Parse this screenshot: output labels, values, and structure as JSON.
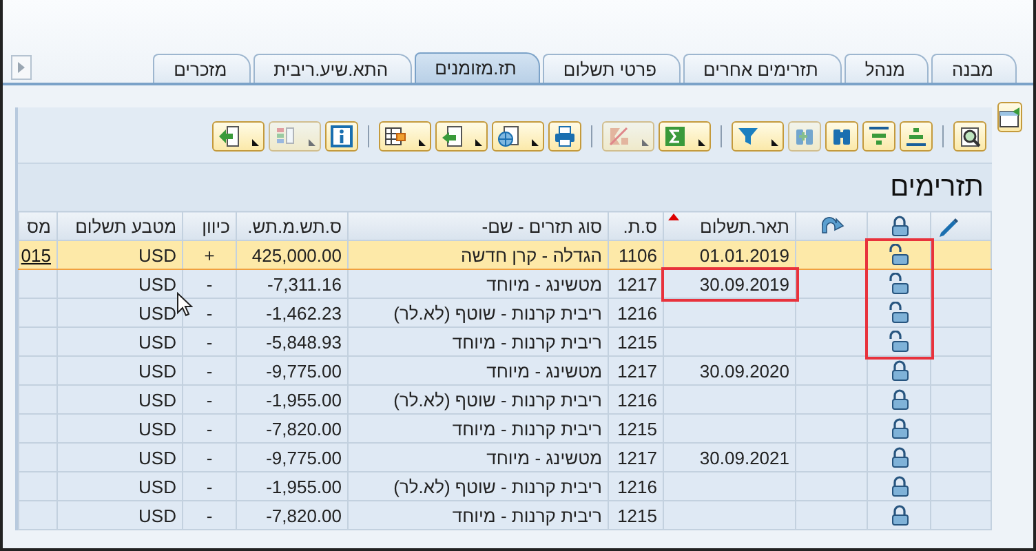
{
  "tabs": [
    {
      "label": "מבנה",
      "selected": false
    },
    {
      "label": "מנהל",
      "selected": false
    },
    {
      "label": "תזרימים אחרים",
      "selected": false
    },
    {
      "label": "פרטי תשלום",
      "selected": false
    },
    {
      "label": "תז.מזומנים",
      "selected": true
    },
    {
      "label": "התא.שיע.ריבית",
      "selected": false
    },
    {
      "label": "מזכרים",
      "selected": false
    }
  ],
  "toolbar": [
    {
      "kind": "detail",
      "dropdown": false,
      "disabled": false
    },
    {
      "kind": "separator"
    },
    {
      "kind": "sort_asc",
      "dropdown": false,
      "disabled": false
    },
    {
      "kind": "sort_desc",
      "dropdown": false,
      "disabled": false
    },
    {
      "kind": "find",
      "dropdown": false,
      "disabled": false
    },
    {
      "kind": "find_next",
      "dropdown": false,
      "disabled": true
    },
    {
      "kind": "filter",
      "dropdown": true,
      "disabled": false
    },
    {
      "kind": "separator"
    },
    {
      "kind": "sum",
      "dropdown": true,
      "disabled": false
    },
    {
      "kind": "subtotal",
      "dropdown": true,
      "disabled": true
    },
    {
      "kind": "separator"
    },
    {
      "kind": "print",
      "dropdown": false,
      "disabled": false
    },
    {
      "kind": "view",
      "dropdown": true,
      "disabled": false
    },
    {
      "kind": "export",
      "dropdown": true,
      "disabled": false
    },
    {
      "kind": "layout",
      "dropdown": true,
      "disabled": false
    },
    {
      "kind": "separator"
    },
    {
      "kind": "info",
      "dropdown": false,
      "disabled": false
    },
    {
      "kind": "columns",
      "dropdown": true,
      "disabled": true
    },
    {
      "kind": "send",
      "dropdown": true,
      "disabled": false
    }
  ],
  "table": {
    "title": "תזרימים",
    "columns": [
      {
        "kind": "edit"
      },
      {
        "kind": "lock"
      },
      {
        "kind": "refresh"
      },
      {
        "kind": "date",
        "label": "תאר.תשלום",
        "sorted": true
      },
      {
        "kind": "text",
        "label": "ס.ת.",
        "sorted": false
      },
      {
        "kind": "text",
        "label": "סוג תזרים - שם-",
        "sorted": false
      },
      {
        "kind": "number",
        "label": "ס.תש.מ.תש.",
        "sorted": false
      },
      {
        "kind": "center",
        "label": "כיוון",
        "sorted": false
      },
      {
        "kind": "text",
        "label": "מטבע תשלום",
        "sorted": false
      },
      {
        "kind": "link",
        "label": "מס",
        "sorted": false
      }
    ],
    "rows": [
      {
        "selected": true,
        "locked": false,
        "lock_marked": true,
        "date": "01.01.2019",
        "flow_type": "1106",
        "name": "הגדלה - קרן חדשה",
        "amount": "425,000.00",
        "direction": "+",
        "currency": "USD",
        "column_10": "015"
      },
      {
        "selected": false,
        "locked": false,
        "lock_marked": true,
        "date": "30.09.2019",
        "date_marked": true,
        "flow_type": "1217",
        "name": "מטשינג - מיוחד",
        "amount": "-7,311.16",
        "direction": "-",
        "currency": "USD"
      },
      {
        "selected": false,
        "locked": false,
        "lock_marked": true,
        "flow_type": "1216",
        "name": "ריבית קרנות - שוטף (לא.לר)",
        "amount": "-1,462.23",
        "direction": "-",
        "currency": "USD"
      },
      {
        "selected": false,
        "locked": false,
        "lock_marked": true,
        "flow_type": "1215",
        "name": "ריבית קרנות - מיוחד",
        "amount": "-5,848.93",
        "direction": "-",
        "currency": "USD"
      },
      {
        "selected": false,
        "locked": true,
        "date": "30.09.2020",
        "flow_type": "1217",
        "name": "מטשינג - מיוחד",
        "amount": "-9,775.00",
        "direction": "-",
        "currency": "USD"
      },
      {
        "selected": false,
        "locked": true,
        "flow_type": "1216",
        "name": "ריבית קרנות - שוטף (לא.לר)",
        "amount": "-1,955.00",
        "direction": "-",
        "currency": "USD"
      },
      {
        "selected": false,
        "locked": true,
        "flow_type": "1215",
        "name": "ריבית קרנות - מיוחד",
        "amount": "-7,820.00",
        "direction": "-",
        "currency": "USD"
      },
      {
        "selected": false,
        "locked": true,
        "date": "30.09.2021",
        "flow_type": "1217",
        "name": "מטשינג - מיוחד",
        "amount": "-9,775.00",
        "direction": "-",
        "currency": "USD"
      },
      {
        "selected": false,
        "locked": true,
        "flow_type": "1216",
        "name": "ריבית קרנות - שוטף (לא.לר)",
        "amount": "-1,955.00",
        "direction": "-",
        "currency": "USD"
      },
      {
        "selected": false,
        "locked": true,
        "flow_type": "1215",
        "name": "ריבית קרנות - מיוחד",
        "amount": "-7,820.00",
        "direction": "-",
        "currency": "USD"
      }
    ]
  }
}
